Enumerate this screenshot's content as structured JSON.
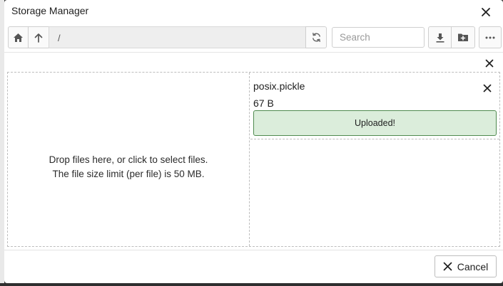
{
  "dialog": {
    "title": "Storage Manager"
  },
  "toolbar": {
    "path": "/",
    "search_placeholder": "Search"
  },
  "dropzone": {
    "line1": "Drop files here, or click to select files.",
    "line2": "The file size limit (per file) is 50 MB."
  },
  "files": [
    {
      "name": "posix.pickle",
      "size": "67 B",
      "status": "Uploaded!"
    }
  ],
  "footer": {
    "cancel_label": "Cancel"
  },
  "icons": {
    "home": "home-icon",
    "up": "arrow-up-icon",
    "refresh": "refresh-icon",
    "download": "download-icon",
    "new_folder": "new-folder-icon",
    "more": "more-horizontal-icon",
    "close": "close-icon"
  },
  "colors": {
    "success_bg": "#dbeddb",
    "success_border": "#4f8a4f"
  }
}
